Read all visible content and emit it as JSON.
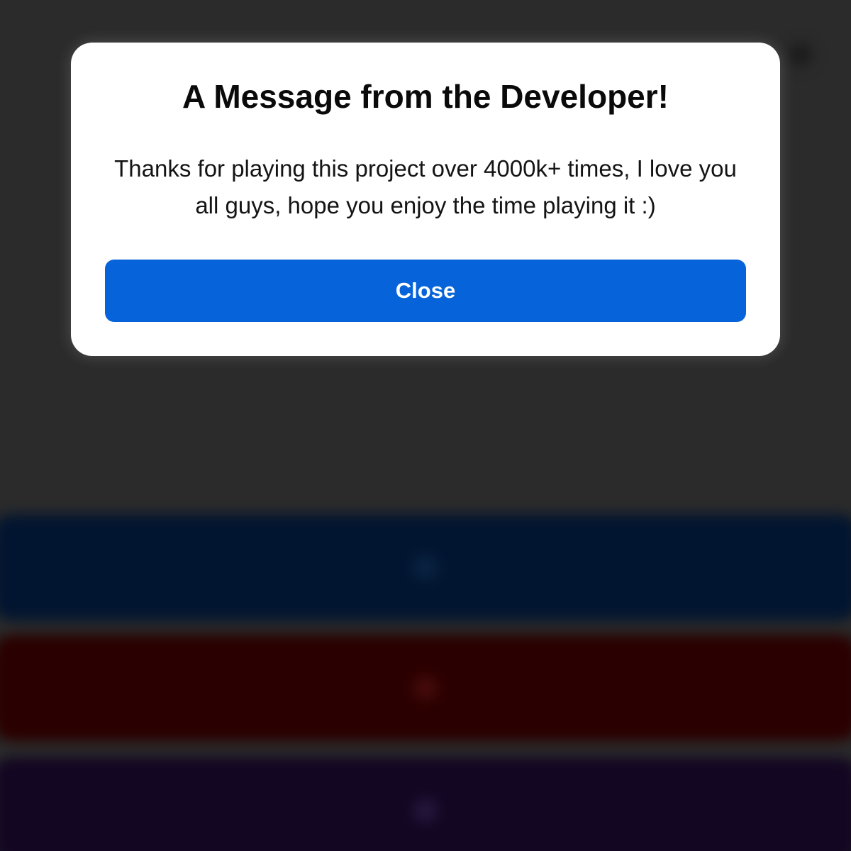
{
  "modal": {
    "title": "A Message from the Developer!",
    "message": "Thanks for playing this project over 4000k+ times, I love you all guys, hope you enjoy the time playing it :)",
    "close_label": "Close"
  },
  "colors": {
    "backdrop": "#2b2b2b",
    "modal_background": "#ffffff",
    "primary_button": "#0663d9",
    "bg_button_blue": "#021530",
    "bg_button_red": "#2b0000",
    "bg_button_purple": "#130622"
  },
  "icons": {
    "corner": "settings-icon",
    "bg_button_1": "play-icon",
    "bg_button_2": "circle-icon",
    "bg_button_3": "info-icon"
  }
}
